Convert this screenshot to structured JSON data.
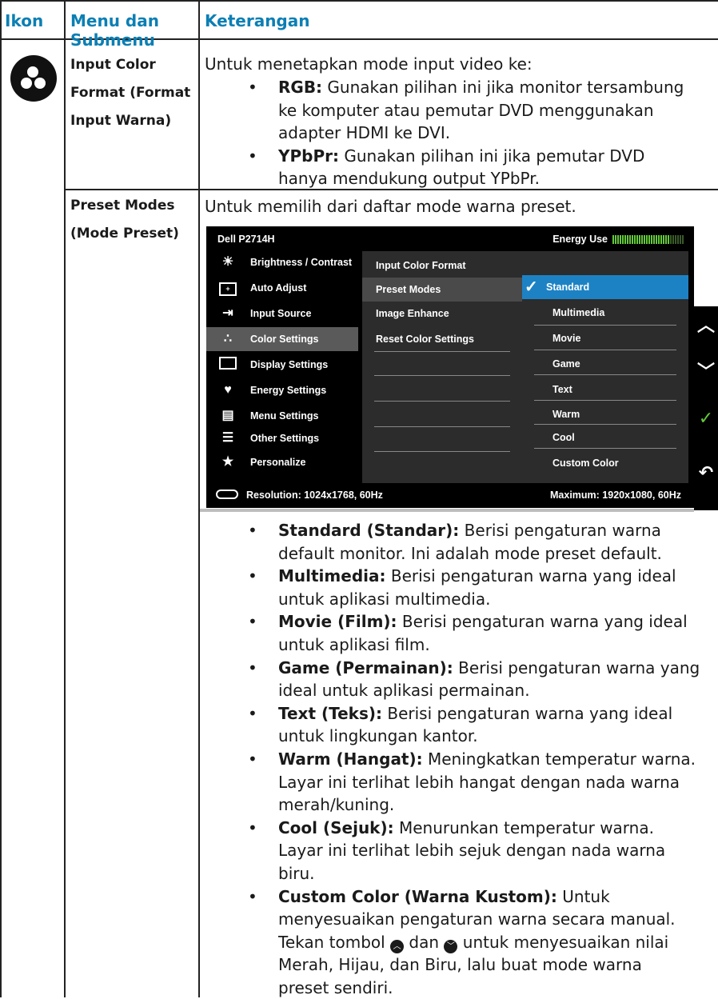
{
  "header": {
    "col_icon": "Ikon",
    "col_menu": "Menu dan Submenu",
    "col_desc": "Keterangan"
  },
  "icon_row": {
    "icon": "color-settings-icon"
  },
  "input_color_format": {
    "label_line1": "Input Color",
    "label_line2": "Format (Format",
    "label_line3": "Input Warna)",
    "intro": "Untuk menetapkan mode input video ke:",
    "items": [
      {
        "term": "RGB:",
        "line1": " Gunakan pilihan ini jika monitor tersambung",
        "line2": "ke komputer atau pemutar DVD menggunakan",
        "line3": "adapter HDMI ke DVI."
      },
      {
        "term": "YPbPr:",
        "line1": " Gunakan pilihan ini jika pemutar DVD",
        "line2": "hanya mendukung output YPbPr.",
        "line3": ""
      }
    ]
  },
  "preset_modes": {
    "label_line1": "Preset Modes",
    "label_line2": "(Mode Preset)",
    "intro": "Untuk memilih dari daftar mode warna preset."
  },
  "osd": {
    "title": "Dell P2714H",
    "energy_label": "Energy Use",
    "energy_level": 0.8,
    "accent": "#1d82c4",
    "left_menu": [
      {
        "label": "Brightness / Contrast",
        "icon": "brightness-icon"
      },
      {
        "label": "Auto Adjust",
        "icon": "auto-adjust-icon"
      },
      {
        "label": "Input Source",
        "icon": "input-source-icon"
      },
      {
        "label": "Color Settings",
        "icon": "color-settings-icon",
        "selected": true
      },
      {
        "label": "Display Settings",
        "icon": "display-settings-icon"
      },
      {
        "label": "Energy Settings",
        "icon": "energy-settings-icon"
      },
      {
        "label": "Menu Settings",
        "icon": "menu-settings-icon"
      },
      {
        "label": "Other Settings",
        "icon": "other-settings-icon"
      },
      {
        "label": "Personalize",
        "icon": "star-icon"
      }
    ],
    "mid_menu": [
      {
        "label": "Input Color Format"
      },
      {
        "label": "Preset Modes",
        "selected": true
      },
      {
        "label": "Image Enhance"
      },
      {
        "label": "Reset Color Settings"
      }
    ],
    "right_menu": [
      {
        "label": "Standard",
        "selected": true
      },
      {
        "label": "Multimedia"
      },
      {
        "label": "Movie"
      },
      {
        "label": "Game"
      },
      {
        "label": "Text"
      },
      {
        "label": "Warm"
      },
      {
        "label": "Cool"
      },
      {
        "label": "Custom Color"
      }
    ],
    "resolution": "Resolution: 1024x1768, 60Hz",
    "maximum": "Maximum: 1920x1080, 60Hz",
    "side_buttons": [
      "up-arrow-icon",
      "down-arrow-icon",
      "check-icon",
      "back-icon"
    ]
  },
  "preset_list": [
    {
      "term": "Standard (Standar):",
      "lines": [
        " Berisi pengaturan warna",
        "default monitor. Ini adalah mode preset default."
      ]
    },
    {
      "term": "Multimedia:",
      "lines": [
        " Berisi pengaturan warna yang ideal",
        "untuk aplikasi multimedia."
      ]
    },
    {
      "term": "Movie (Film):",
      "lines": [
        " Berisi pengaturan warna yang ideal",
        "untuk aplikasi film."
      ]
    },
    {
      "term": "Game (Permainan):",
      "lines": [
        " Berisi pengaturan warna yang",
        "ideal untuk aplikasi permainan."
      ]
    },
    {
      "term": "Text (Teks):",
      "lines": [
        " Berisi pengaturan warna yang ideal",
        "untuk lingkungan kantor."
      ]
    },
    {
      "term": "Warm (Hangat):",
      "lines": [
        " Meningkatkan temperatur warna.",
        "Layar ini terlihat lebih hangat dengan nada warna",
        "merah/kuning."
      ]
    },
    {
      "term": "Cool (Sejuk):",
      "lines": [
        " Menurunkan temperatur warna.",
        "Layar ini terlihat lebih sejuk dengan nada warna",
        "biru."
      ]
    }
  ],
  "custom_color": {
    "term": "Custom Color (Warna Kustom):",
    "line1": " Untuk",
    "line2": "menyesuaikan pengaturan warna secara manual.",
    "line3a": "Tekan tombol",
    "line3b": "dan",
    "line3c": "untuk menyesuaikan nilai",
    "line4": "Merah, Hijau, dan Biru, lalu buat mode warna",
    "line5": "preset sendiri."
  }
}
